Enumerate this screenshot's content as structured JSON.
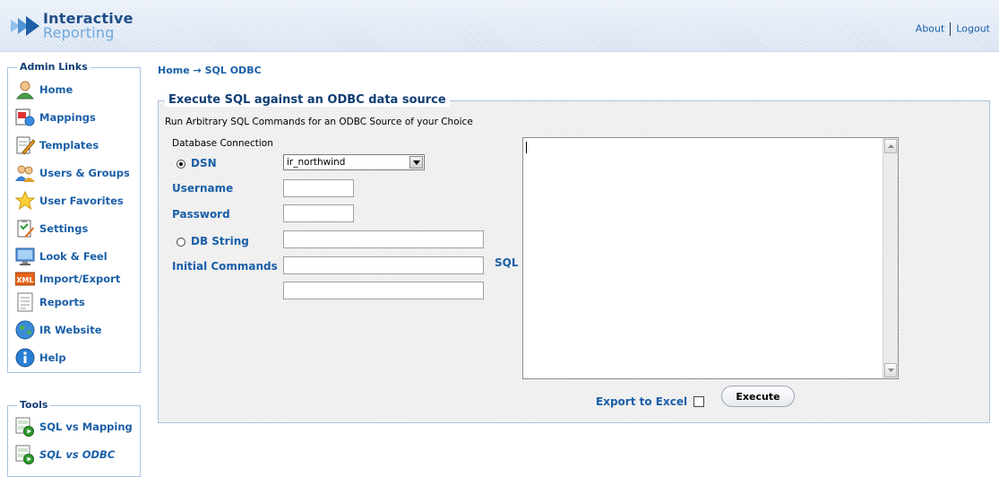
{
  "header": {
    "logo_line1": "Interactive",
    "logo_line2": "Reporting",
    "links": {
      "about": "About",
      "logout": "Logout"
    }
  },
  "sidebar": {
    "admin_title": "Admin Links",
    "admin_items": [
      {
        "label": "Home",
        "icon": "user-icon"
      },
      {
        "label": "Mappings",
        "icon": "mappings-icon"
      },
      {
        "label": "Templates",
        "icon": "templates-icon"
      },
      {
        "label": "Users & Groups",
        "icon": "users-groups-icon"
      },
      {
        "label": "User Favorites",
        "icon": "star-icon"
      },
      {
        "label": "Settings",
        "icon": "settings-icon"
      },
      {
        "label": "Look & Feel",
        "icon": "monitor-icon"
      },
      {
        "label": "Import/Export",
        "icon": "xml-icon"
      },
      {
        "label": "Reports",
        "icon": "report-icon"
      },
      {
        "label": "IR Website",
        "icon": "globe-icon"
      },
      {
        "label": "Help",
        "icon": "info-icon"
      }
    ],
    "tools_title": "Tools",
    "tools_items": [
      {
        "label": "SQL vs Mapping",
        "icon": "sql-tool-icon"
      },
      {
        "label": "SQL vs ODBC",
        "icon": "sql-tool-icon",
        "active": true
      }
    ]
  },
  "breadcrumb": {
    "home": "Home",
    "arrow": "→",
    "current": "SQL ODBC"
  },
  "main": {
    "title": "Execute SQL against an ODBC data source",
    "subtitle": "Run Arbitrary SQL Commands for an ODBC Source of your Choice",
    "db_connection_label": "Database Connection",
    "dsn_label": "DSN",
    "dsn_selected": true,
    "dsn_value": "ir_northwind",
    "username_label": "Username",
    "username_value": "",
    "password_label": "Password",
    "password_value": "",
    "dbstring_label": "DB String",
    "dbstring_selected": false,
    "dbstring_value": "",
    "initial_commands_label": "Initial Commands",
    "initial_commands_value_1": "",
    "initial_commands_value_2": "",
    "sql_label": "SQL",
    "sql_value": "",
    "export_label": "Export to Excel",
    "export_checked": false,
    "execute_label": "Execute"
  },
  "colors": {
    "link_blue": "#1a5fa8",
    "title_navy": "#0f3d73",
    "border_blue": "#a9c2e0"
  }
}
